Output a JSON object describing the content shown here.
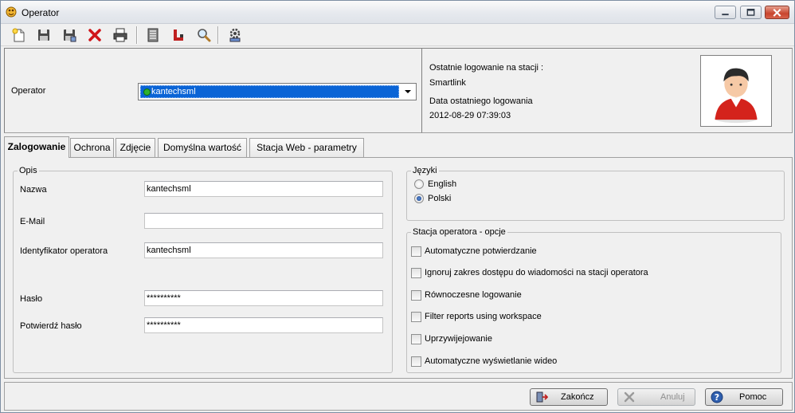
{
  "window": {
    "title": "Operator"
  },
  "top": {
    "operator_label": "Operator",
    "operator_value": "kantechsml",
    "last_login_station_label": "Ostatnie logowanie na stacji :",
    "last_login_station_value": "Smartlink",
    "last_login_date_label": "Data ostatniego logowania",
    "last_login_date_value": "2012-08-29 07:39:03"
  },
  "tabs": [
    {
      "label": "Zalogowanie"
    },
    {
      "label": "Ochrona"
    },
    {
      "label": "Zdjęcie"
    },
    {
      "label": "Domyślna wartość"
    },
    {
      "label": "Stacja Web - parametry"
    }
  ],
  "opis": {
    "legend": "Opis",
    "name_label": "Nazwa",
    "name_value": "kantechsml",
    "email_label": "E-Mail",
    "email_value": "",
    "id_label": "Identyfikator operatora",
    "id_value": "kantechsml",
    "password_label": "Hasło",
    "password_value": "**********",
    "confirm_label": "Potwierdź hasło",
    "confirm_value": "**********"
  },
  "languages": {
    "legend": "Języki",
    "options": [
      {
        "label": "English",
        "checked": false
      },
      {
        "label": "Polski",
        "checked": true
      }
    ]
  },
  "station_options": {
    "legend": "Stacja operatora - opcje",
    "items": [
      {
        "label": "Automatyczne potwierdzanie",
        "checked": false
      },
      {
        "label": "Ignoruj zakres dostępu do wiadomości na stacji operatora",
        "checked": false
      },
      {
        "label": "Równoczesne logowanie",
        "checked": false
      },
      {
        "label": "Filter reports using workspace",
        "checked": false
      },
      {
        "label": "Uprzywijejowanie",
        "checked": false
      },
      {
        "label": "Automatyczne wyświetlanie wideo",
        "checked": false
      }
    ]
  },
  "buttons": {
    "finish": "Zakończ",
    "cancel": "Anuluj",
    "help": "Pomoc"
  },
  "colors": {
    "selection": "#0a64d6",
    "close_button": "#c8452d",
    "delete_icon": "#d0161b"
  }
}
